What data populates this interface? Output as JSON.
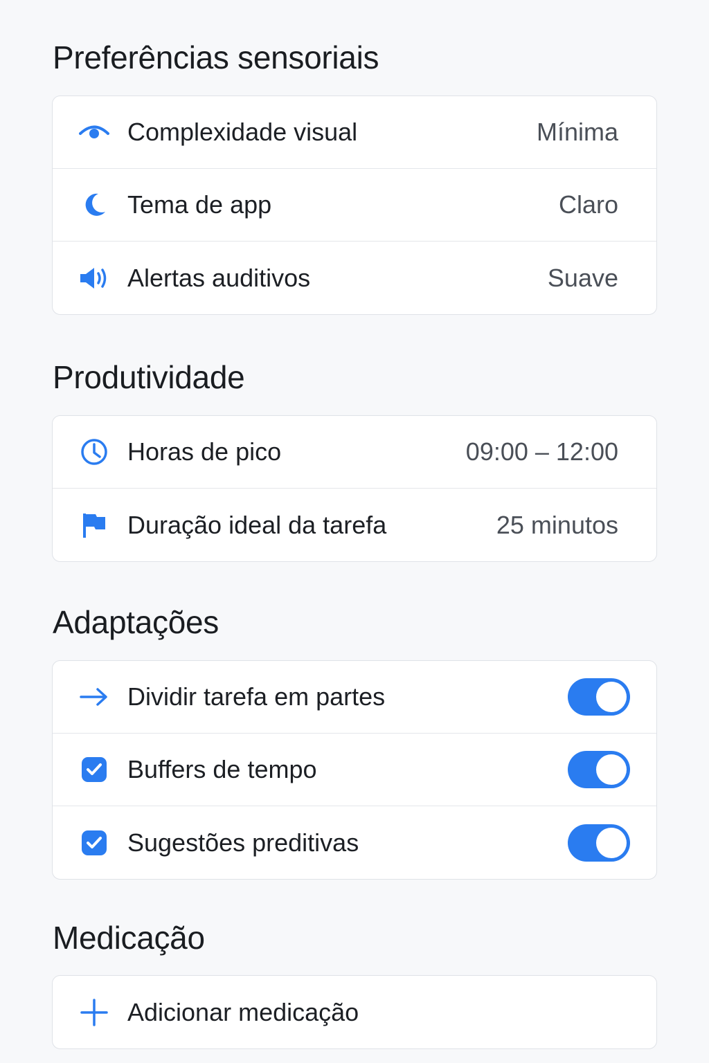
{
  "colors": {
    "accent": "#2a7cf0",
    "background": "#f7f8fa",
    "card": "#ffffff"
  },
  "sensory": {
    "title": "Preferências sensoriais",
    "items": [
      {
        "icon": "eye-icon",
        "label": "Complexidade visual",
        "value": "Mínima"
      },
      {
        "icon": "moon-icon",
        "label": "Tema de app",
        "value": "Claro"
      },
      {
        "icon": "speaker-icon",
        "label": "Alertas auditivos",
        "value": "Suave"
      }
    ]
  },
  "productivity": {
    "title": "Produtividade",
    "items": [
      {
        "icon": "clock-icon",
        "label": "Horas de pico",
        "value": "09:00 – 12:00"
      },
      {
        "icon": "flag-icon",
        "label": "Duração ideal da tarefa",
        "value": "25 minutos"
      }
    ]
  },
  "adaptations": {
    "title": "Adaptações",
    "items": [
      {
        "icon": "arrow-right-icon",
        "label": "Dividir tarefa em partes",
        "enabled": true
      },
      {
        "icon": "checkbox-icon",
        "label": "Buffers de tempo",
        "enabled": true
      },
      {
        "icon": "checkbox-icon",
        "label": "Sugestões preditivas",
        "enabled": true
      }
    ]
  },
  "medication": {
    "title": "Medicação",
    "add_icon": "plus-icon",
    "add_label": "Adicionar medicação"
  }
}
